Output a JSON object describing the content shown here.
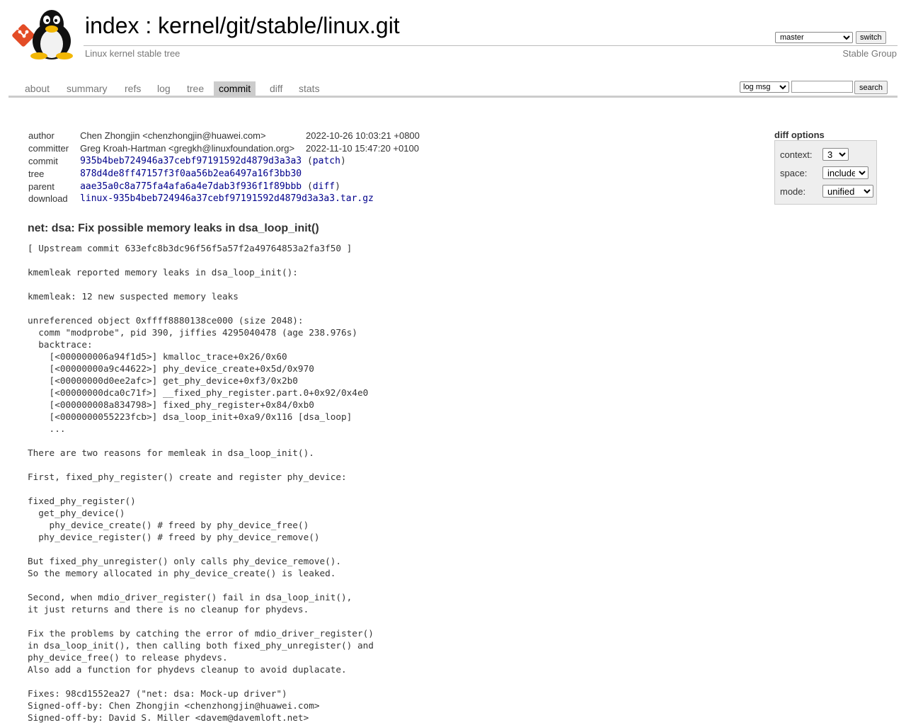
{
  "header": {
    "title_index": "index",
    "title_separator": " : ",
    "title_repo": "kernel/git/stable/linux.git",
    "subtitle": "Linux kernel stable tree",
    "owner": "Stable Group",
    "branch_selected": "master",
    "switch_label": "switch",
    "logo_icons": [
      "git-logo-icon",
      "tux-penguin-icon"
    ]
  },
  "tabs": [
    {
      "label": "about",
      "active": false
    },
    {
      "label": "summary",
      "active": false
    },
    {
      "label": "refs",
      "active": false
    },
    {
      "label": "log",
      "active": false
    },
    {
      "label": "tree",
      "active": false
    },
    {
      "label": "commit",
      "active": true
    },
    {
      "label": "diff",
      "active": false
    },
    {
      "label": "stats",
      "active": false
    }
  ],
  "search": {
    "type_selected": "log msg",
    "value": "",
    "button_label": "search"
  },
  "commit_info": {
    "author_label": "author",
    "author": "Chen Zhongjin <chenzhongjin@huawei.com>",
    "author_date": "2022-10-26 10:03:21 +0800",
    "committer_label": "committer",
    "committer": "Greg Kroah-Hartman <gregkh@linuxfoundation.org>",
    "committer_date": "2022-11-10 15:47:20 +0100",
    "commit_label": "commit",
    "commit_hash": "935b4beb724946a37cebf97191592d4879d3a3a3",
    "commit_extra": "patch",
    "tree_label": "tree",
    "tree_hash": "878d4de8ff47157f3f0aa56b2ea6497a16f3bb30",
    "parent_label": "parent",
    "parent_hash": "aae35a0c8a775fa4afa6a4e7dab3f936f1f89bbb",
    "parent_extra": "diff",
    "download_label": "download",
    "download_file": "linux-935b4beb724946a37cebf97191592d4879d3a3a3.tar.gz"
  },
  "diff_options": {
    "title": "diff options",
    "context_label": "context:",
    "context_value": "3",
    "space_label": "space:",
    "space_value": "include",
    "mode_label": "mode:",
    "mode_value": "unified"
  },
  "commit": {
    "subject": "net: dsa: Fix possible memory leaks in dsa_loop_init()",
    "message": "[ Upstream commit 633efc8b3dc96f56f5a57f2a49764853a2fa3f50 ]\n\nkmemleak reported memory leaks in dsa_loop_init():\n\nkmemleak: 12 new suspected memory leaks\n\nunreferenced object 0xffff8880138ce000 (size 2048):\n  comm \"modprobe\", pid 390, jiffies 4295040478 (age 238.976s)\n  backtrace:\n    [<000000006a94f1d5>] kmalloc_trace+0x26/0x60\n    [<00000000a9c44622>] phy_device_create+0x5d/0x970\n    [<00000000d0ee2afc>] get_phy_device+0xf3/0x2b0\n    [<00000000dca0c71f>] __fixed_phy_register.part.0+0x92/0x4e0\n    [<000000008a834798>] fixed_phy_register+0x84/0xb0\n    [<0000000055223fcb>] dsa_loop_init+0xa9/0x116 [dsa_loop]\n    ...\n\nThere are two reasons for memleak in dsa_loop_init().\n\nFirst, fixed_phy_register() create and register phy_device:\n\nfixed_phy_register()\n  get_phy_device()\n    phy_device_create() # freed by phy_device_free()\n  phy_device_register() # freed by phy_device_remove()\n\nBut fixed_phy_unregister() only calls phy_device_remove().\nSo the memory allocated in phy_device_create() is leaked.\n\nSecond, when mdio_driver_register() fail in dsa_loop_init(),\nit just returns and there is no cleanup for phydevs.\n\nFix the problems by catching the error of mdio_driver_register()\nin dsa_loop_init(), then calling both fixed_phy_unregister() and\nphy_device_free() to release phydevs.\nAlso add a function for phydevs cleanup to avoid duplacate.\n\nFixes: 98cd1552ea27 (\"net: dsa: Mock-up driver\")\nSigned-off-by: Chen Zhongjin <chenzhongjin@huawei.com>\nSigned-off-by: David S. Miller <davem@davemloft.net>"
  },
  "colors": {
    "link": "#00008b",
    "text": "#333333",
    "muted": "#777777",
    "tab_active_bg": "#cccccc",
    "git_logo": "#e34c26"
  }
}
